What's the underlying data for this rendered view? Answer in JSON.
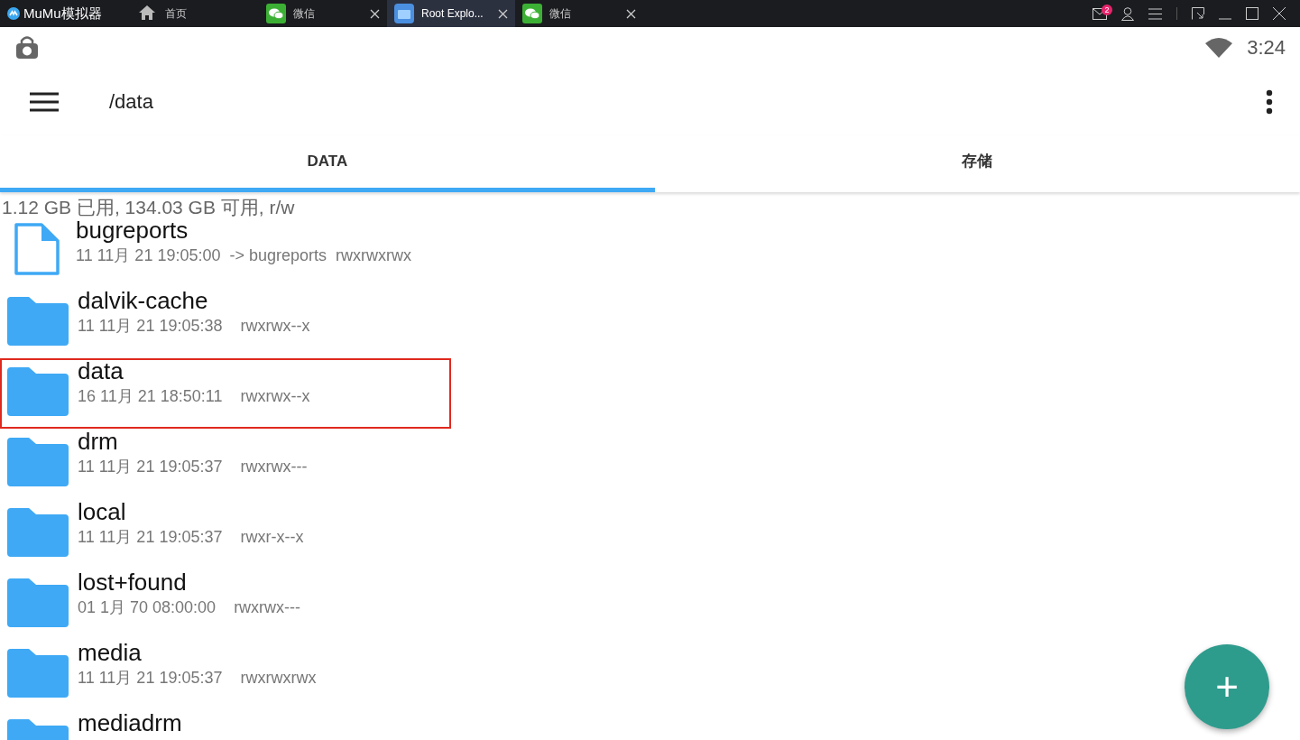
{
  "window": {
    "app_name": "MuMu模拟器",
    "tabs": [
      {
        "label": "首页",
        "kind": "home",
        "closable": false,
        "selected": false
      },
      {
        "label": "微信",
        "kind": "chat",
        "closable": true,
        "selected": false
      },
      {
        "label": "Root Explo...",
        "kind": "explorer",
        "closable": true,
        "selected": true
      },
      {
        "label": "微信",
        "kind": "chat",
        "closable": true,
        "selected": false
      }
    ],
    "mail_badge": "2"
  },
  "status_bar": {
    "time": "3:24"
  },
  "toolbar": {
    "path": "/data"
  },
  "tabs": [
    {
      "label": "DATA",
      "selected": true
    },
    {
      "label": "存储",
      "selected": false
    }
  ],
  "storage_info": "1.12 GB 已用, 134.03 GB 可用, r/w",
  "files": [
    {
      "name": "bugreports",
      "kind": "file",
      "date": "11 11月 21 19:05:00",
      "link": "-> bugreports",
      "permissions": "rwxrwxrwx",
      "highlighted": false
    },
    {
      "name": "dalvik-cache",
      "kind": "folder",
      "date": "11 11月 21 19:05:38",
      "permissions": "rwxrwx--x",
      "highlighted": false
    },
    {
      "name": "data",
      "kind": "folder",
      "date": "16 11月 21 18:50:11",
      "permissions": "rwxrwx--x",
      "highlighted": true
    },
    {
      "name": "drm",
      "kind": "folder",
      "date": "11 11月 21 19:05:37",
      "permissions": "rwxrwx---",
      "highlighted": false
    },
    {
      "name": "local",
      "kind": "folder",
      "date": "11 11月 21 19:05:37",
      "permissions": "rwxr-x--x",
      "highlighted": false
    },
    {
      "name": "lost+found",
      "kind": "folder",
      "date": "01 1月 70 08:00:00",
      "permissions": "rwxrwx---",
      "highlighted": false
    },
    {
      "name": "media",
      "kind": "folder",
      "date": "11 11月 21 19:05:37",
      "permissions": "rwxrwxrwx",
      "highlighted": false
    },
    {
      "name": "mediadrm",
      "kind": "folder",
      "highlighted": false
    }
  ],
  "fab": {
    "label": "+"
  }
}
